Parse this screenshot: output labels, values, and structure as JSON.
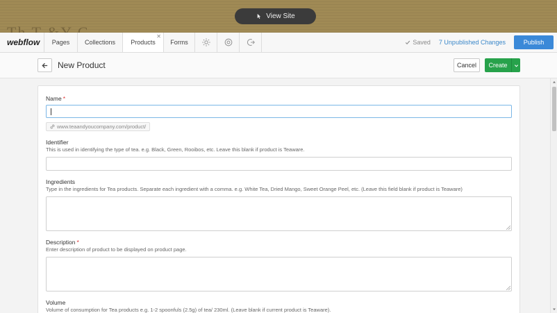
{
  "site_preview": {
    "brand_text": "Th  T   &Y  C",
    "view_site_label": "View Site"
  },
  "topnav": {
    "logo": "webflow",
    "tabs": [
      {
        "label": "Pages"
      },
      {
        "label": "Collections"
      },
      {
        "label": "Products"
      },
      {
        "label": "Forms"
      }
    ],
    "icons": [
      "gear-icon",
      "settings-cog-icon",
      "integrations-icon"
    ],
    "saved_label": "Saved",
    "unpublished_label": "7 Unpublished Changes",
    "publish_label": "Publish"
  },
  "header": {
    "title": "New Product",
    "cancel_label": "Cancel",
    "create_label": "Create"
  },
  "form": {
    "name": {
      "label": "Name",
      "required": "*",
      "value": "",
      "slug": "www.teaandyoucompany.com/product/"
    },
    "identifier": {
      "label": "Identifier",
      "help": "This is used in identifying the type of tea. e.g. Black, Green, Rooibos, etc. Leave this blank if product is Teaware.",
      "value": ""
    },
    "ingredients": {
      "label": "Ingredients",
      "help": "Type in the ingredients for Tea products. Separate each ingredient with a comma. e.g. White Tea, Dried Mango, Sweet Orange Peel, etc. (Leave this field blank if product is Teaware)",
      "value": ""
    },
    "description": {
      "label": "Description",
      "required": "*",
      "help": "Enter description of product to be displayed on product page.",
      "value": ""
    },
    "volume": {
      "label": "Volume",
      "help": "Volume of consumption for Tea products e.g. 1-2 spoonfuls (2.5g) of tea/ 230ml. (Leave blank if current product is Teaware)."
    }
  },
  "colors": {
    "publish": "#3b89d8",
    "create": "#27a24b",
    "link": "#3a87c9",
    "required": "#dd3333"
  }
}
